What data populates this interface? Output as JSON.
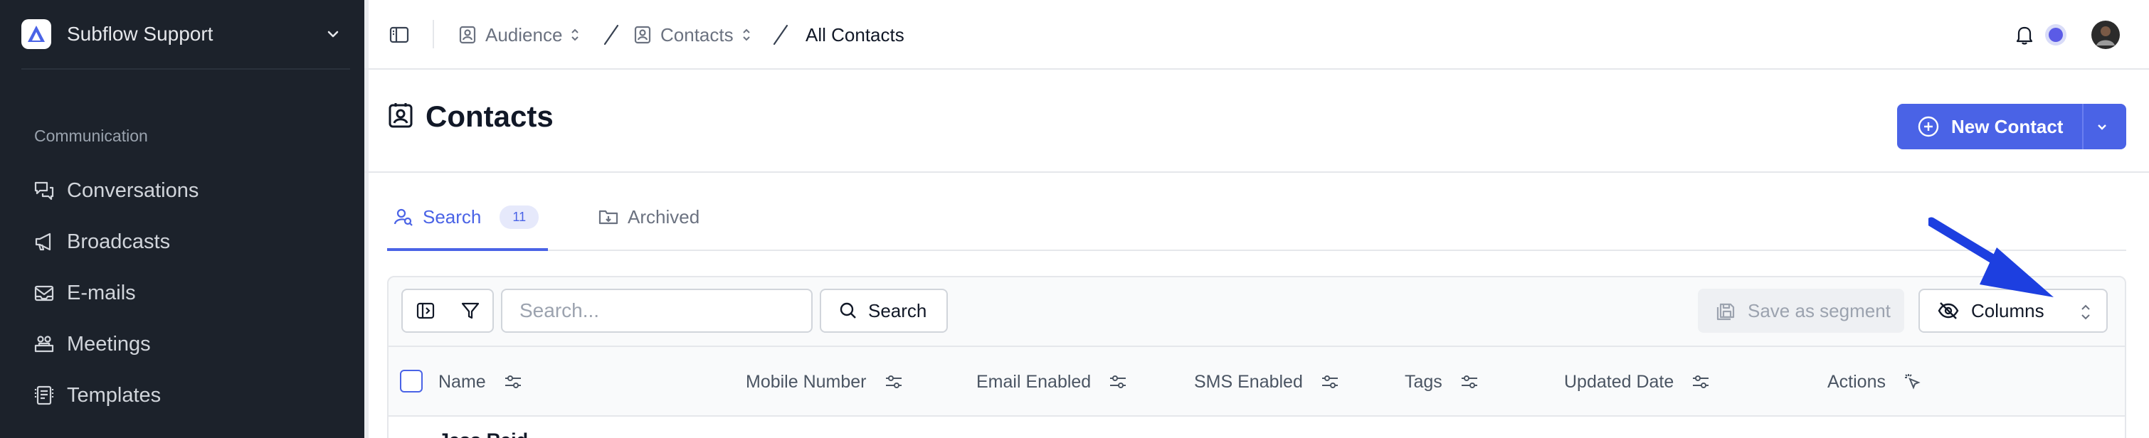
{
  "sidebar": {
    "workspace_name": "Subflow Support",
    "section_label": "Communication",
    "items": [
      {
        "label": "Conversations",
        "icon": "chat-icon"
      },
      {
        "label": "Broadcasts",
        "icon": "megaphone-icon"
      },
      {
        "label": "E-mails",
        "icon": "mail-icon"
      },
      {
        "label": "Meetings",
        "icon": "meeting-icon"
      },
      {
        "label": "Templates",
        "icon": "template-icon"
      }
    ]
  },
  "topbar": {
    "breadcrumbs": [
      "Audience",
      "Contacts",
      "All Contacts"
    ]
  },
  "page": {
    "title": "Contacts",
    "new_button_label": "New Contact"
  },
  "tabs": [
    {
      "label": "Search",
      "count": "11"
    },
    {
      "label": "Archived"
    }
  ],
  "toolbar": {
    "search_placeholder": "Search...",
    "search_button": "Search",
    "save_segment": "Save as segment",
    "columns_button": "Columns"
  },
  "table": {
    "columns": [
      "Name",
      "Mobile Number",
      "Email Enabled",
      "SMS Enabled",
      "Tags",
      "Updated Date",
      "Actions"
    ],
    "first_row_name": "Jess Reid"
  },
  "colors": {
    "accent": "#4a63e6",
    "sidebar_bg": "#1c222b",
    "arrow": "#1d3fe0"
  }
}
